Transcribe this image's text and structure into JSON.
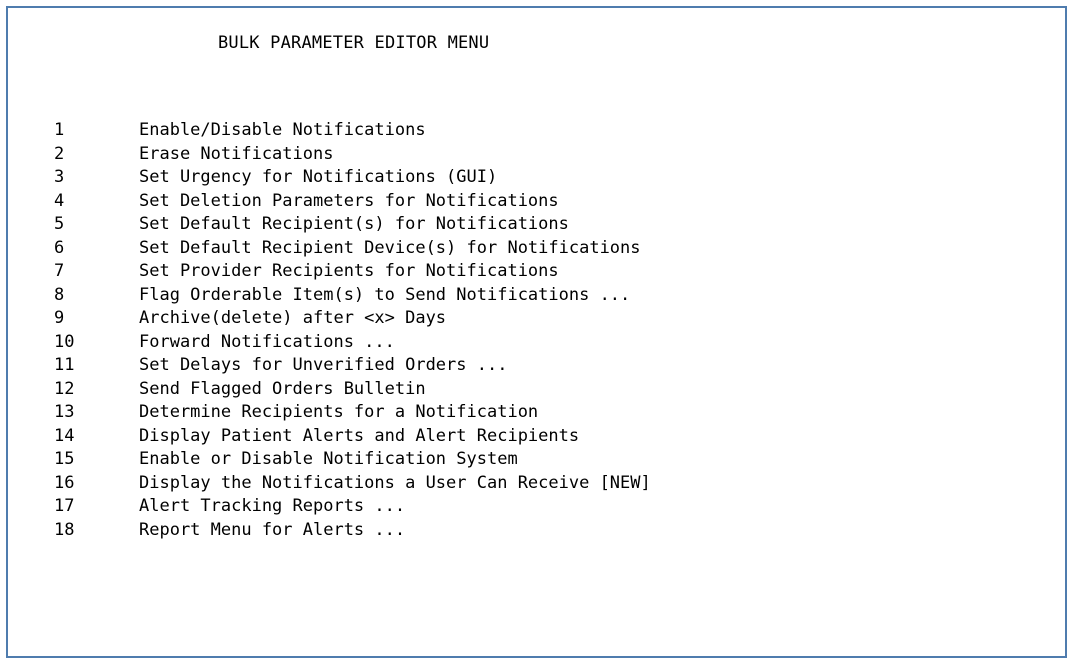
{
  "menu": {
    "title": "BULK PARAMETER EDITOR MENU",
    "items": [
      {
        "num": "1",
        "label": "Enable/Disable Notifications"
      },
      {
        "num": "2",
        "label": "Erase Notifications"
      },
      {
        "num": "3",
        "label": "Set Urgency for Notifications (GUI)"
      },
      {
        "num": "4",
        "label": "Set Deletion Parameters for Notifications"
      },
      {
        "num": "5",
        "label": "Set Default Recipient(s) for Notifications"
      },
      {
        "num": "6",
        "label": "Set Default Recipient Device(s) for Notifications"
      },
      {
        "num": "7",
        "label": "Set Provider Recipients for Notifications"
      },
      {
        "num": "8",
        "label": "Flag Orderable Item(s) to Send Notifications ..."
      },
      {
        "num": "9",
        "label": "Archive(delete) after <x> Days"
      },
      {
        "num": "10",
        "label": "Forward Notifications ..."
      },
      {
        "num": "11",
        "label": "Set Delays for Unverified Orders ..."
      },
      {
        "num": "12",
        "label": "Send Flagged Orders Bulletin"
      },
      {
        "num": "13",
        "label": "Determine Recipients for a Notification"
      },
      {
        "num": "14",
        "label": "Display Patient Alerts and Alert Recipients"
      },
      {
        "num": "15",
        "label": "Enable or Disable Notification System"
      },
      {
        "num": "16",
        "label": "Display the Notifications a User Can Receive [NEW]"
      },
      {
        "num": "17",
        "label": "Alert Tracking Reports ..."
      },
      {
        "num": "18",
        "label": "Report Menu for Alerts ..."
      }
    ]
  }
}
